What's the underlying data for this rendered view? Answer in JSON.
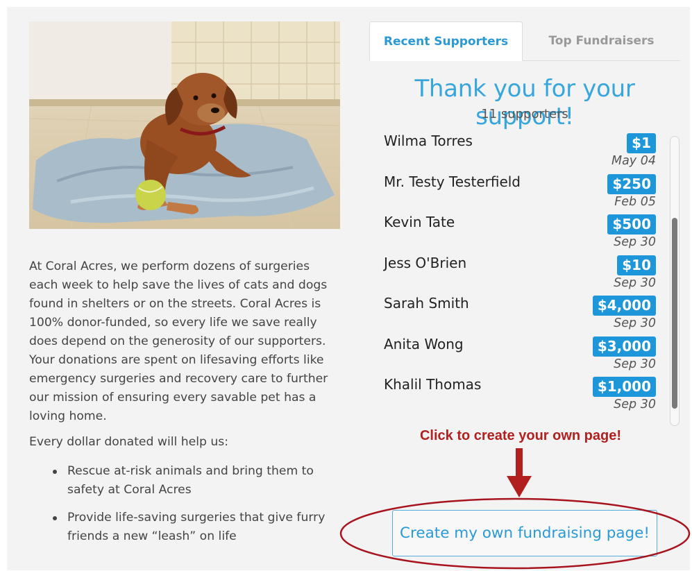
{
  "story": {
    "image_alt": "Dog lying on a blue blanket with a tennis ball",
    "description": "At Coral Acres, we perform dozens of surgeries each week to help save the lives of cats and dogs found in shelters or on the streets. Coral Acres is 100% donor-funded, so every life we save really does depend on the generosity of our supporters. Your donations are spent on lifesaving efforts like emergency surgeries and recovery care to further our mission of ensuring every savable pet has a loving home.",
    "help_intro": "Every dollar donated will help us:",
    "bullets": [
      "Rescue at-risk animals and bring them to safety at Coral Acres",
      "Provide life-saving surgeries that give furry friends a new “leash” on life"
    ]
  },
  "tabs": {
    "recent": "Recent Supporters",
    "top": "Top Fundraisers"
  },
  "supporters_panel": {
    "heading": "Thank you for your support!",
    "count": "11 supporters",
    "rows": [
      {
        "name": "Wilma Torres",
        "amount": "$1",
        "date": "May 04"
      },
      {
        "name": "Mr. Testy Testerfield",
        "amount": "$250",
        "date": "Feb 05"
      },
      {
        "name": "Kevin Tate",
        "amount": "$500",
        "date": "Sep 30"
      },
      {
        "name": "Jess O'Brien",
        "amount": "$10",
        "date": "Sep 30"
      },
      {
        "name": "Sarah Smith",
        "amount": "$4,000",
        "date": "Sep 30"
      },
      {
        "name": "Anita Wong",
        "amount": "$3,000",
        "date": "Sep 30"
      },
      {
        "name": "Khalil Thomas",
        "amount": "$1,000",
        "date": "Sep 30"
      }
    ]
  },
  "annotation": {
    "text": "Click to create your own page!",
    "color": "#b21f1f"
  },
  "cta": {
    "label": "Create my own fundraising page!"
  },
  "colors": {
    "accent": "#2a9ad6",
    "amount_badge": "#1d97d9",
    "annotation": "#b21f1f"
  }
}
